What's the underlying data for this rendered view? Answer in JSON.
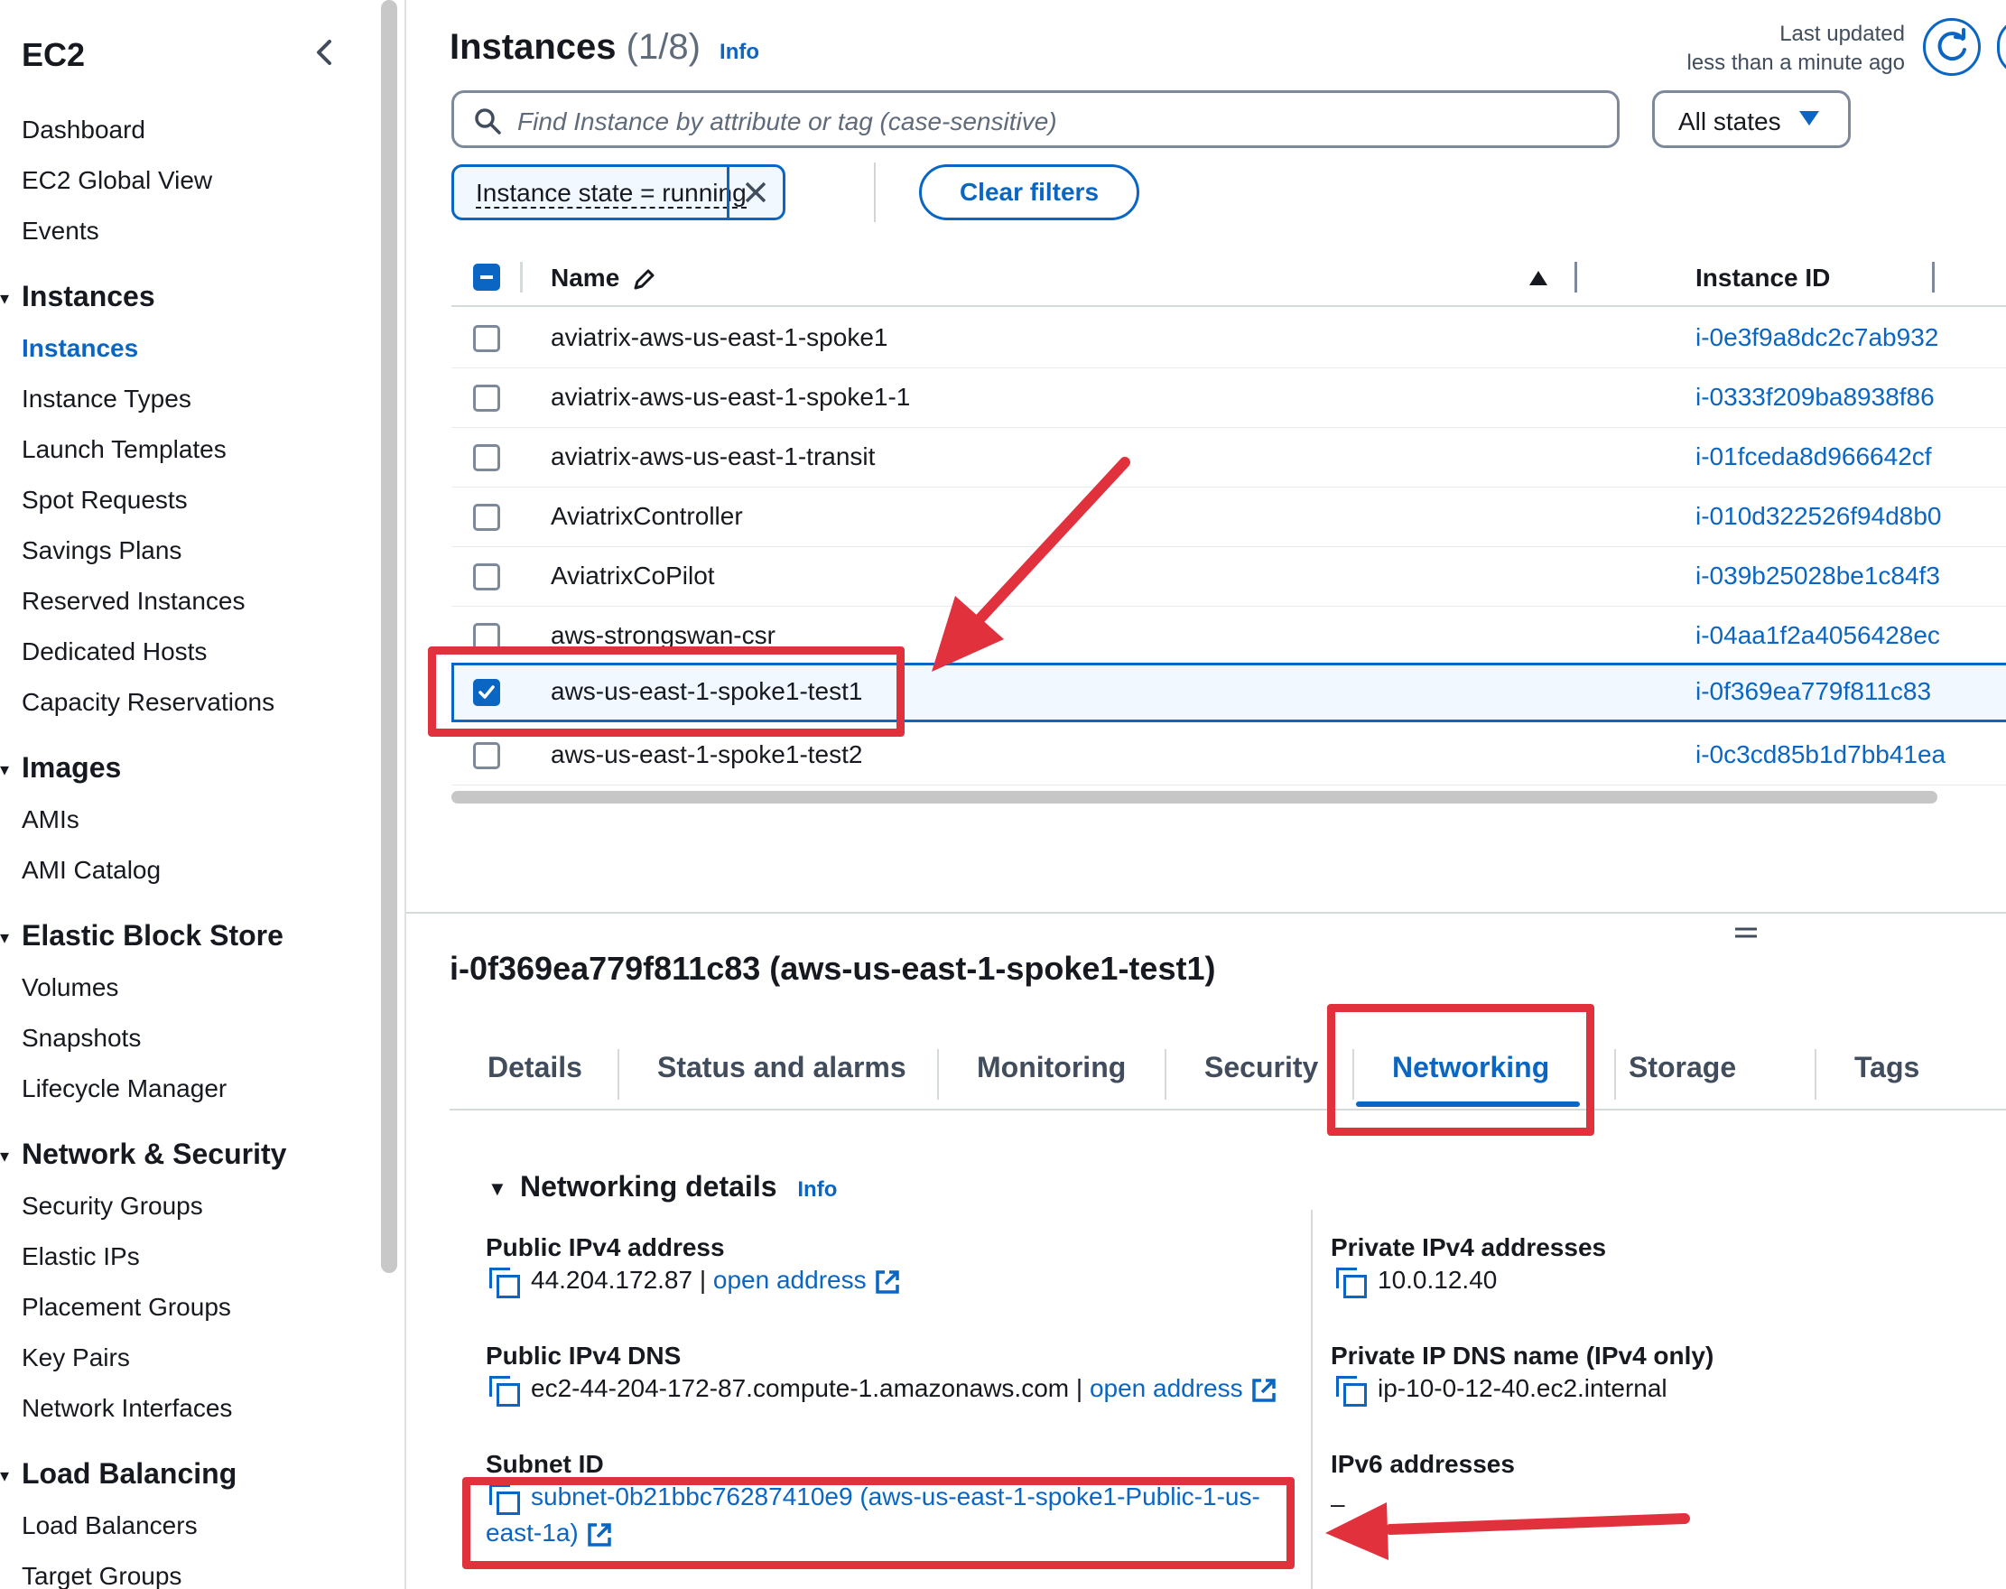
{
  "sidebar": {
    "title": "EC2",
    "top_items": [
      "Dashboard",
      "EC2 Global View",
      "Events"
    ],
    "sections": [
      {
        "label": "Instances",
        "items": [
          "Instances",
          "Instance Types",
          "Launch Templates",
          "Spot Requests",
          "Savings Plans",
          "Reserved Instances",
          "Dedicated Hosts",
          "Capacity Reservations"
        ],
        "active": "Instances"
      },
      {
        "label": "Images",
        "items": [
          "AMIs",
          "AMI Catalog"
        ]
      },
      {
        "label": "Elastic Block Store",
        "items": [
          "Volumes",
          "Snapshots",
          "Lifecycle Manager"
        ]
      },
      {
        "label": "Network & Security",
        "items": [
          "Security Groups",
          "Elastic IPs",
          "Placement Groups",
          "Key Pairs",
          "Network Interfaces"
        ]
      },
      {
        "label": "Load Balancing",
        "items": [
          "Load Balancers",
          "Target Groups"
        ]
      }
    ]
  },
  "header": {
    "title": "Instances",
    "count": "(1/8)",
    "info": "Info",
    "last_updated_line1": "Last updated",
    "last_updated_line2": "less than a minute ago"
  },
  "search": {
    "placeholder": "Find Instance by attribute or tag (case-sensitive)"
  },
  "state_filter": {
    "selected": "All states"
  },
  "filter_chip": {
    "label": "Instance state = running"
  },
  "clear_filters": "Clear filters",
  "table": {
    "columns": [
      "Name",
      "Instance ID"
    ],
    "rows": [
      {
        "name": "aviatrix-aws-us-east-1-spoke1",
        "id": "i-0e3f9a8dc2c7ab932",
        "checked": false
      },
      {
        "name": "aviatrix-aws-us-east-1-spoke1-1",
        "id": "i-0333f209ba8938f86",
        "checked": false
      },
      {
        "name": "aviatrix-aws-us-east-1-transit",
        "id": "i-01fceda8d966642cf",
        "checked": false
      },
      {
        "name": "AviatrixController",
        "id": "i-010d322526f94d8b0",
        "checked": false
      },
      {
        "name": "AviatrixCoPilot",
        "id": "i-039b25028be1c84f3",
        "checked": false
      },
      {
        "name": "aws-strongswan-csr",
        "id": "i-04aa1f2a4056428ec",
        "checked": false
      },
      {
        "name": "aws-us-east-1-spoke1-test1",
        "id": "i-0f369ea779f811c83",
        "checked": true
      },
      {
        "name": "aws-us-east-1-spoke1-test2",
        "id": "i-0c3cd85b1d7bb41ea",
        "checked": false
      }
    ]
  },
  "detail": {
    "title": "i-0f369ea779f811c83 (aws-us-east-1-spoke1-test1)",
    "tabs": [
      "Details",
      "Status and alarms",
      "Monitoring",
      "Security",
      "Networking",
      "Storage",
      "Tags"
    ],
    "active_tab": "Networking",
    "section_title": "Networking details",
    "section_info": "Info",
    "public_ipv4_label": "Public IPv4 address",
    "public_ipv4_value": "44.204.172.87",
    "open_address": "open address",
    "public_dns_label": "Public IPv4 DNS",
    "public_dns_value": "ec2-44-204-172-87.compute-1.amazonaws.com",
    "subnet_label": "Subnet ID",
    "subnet_value_line1": "subnet-0b21bbc76287410e9 (aws-us-east-1-spoke1-Public-1-us-",
    "subnet_value_line2": "east-1a)",
    "private_ipv4_label": "Private IPv4 addresses",
    "private_ipv4_value": "10.0.12.40",
    "private_dns_label": "Private IP DNS name (IPv4 only)",
    "private_dns_value": "ip-10-0-12-40.ec2.internal",
    "ipv6_label": "IPv6 addresses",
    "ipv6_value": "–"
  },
  "colors": {
    "accent": "#0a66c2",
    "annotation": "#e0313d"
  }
}
